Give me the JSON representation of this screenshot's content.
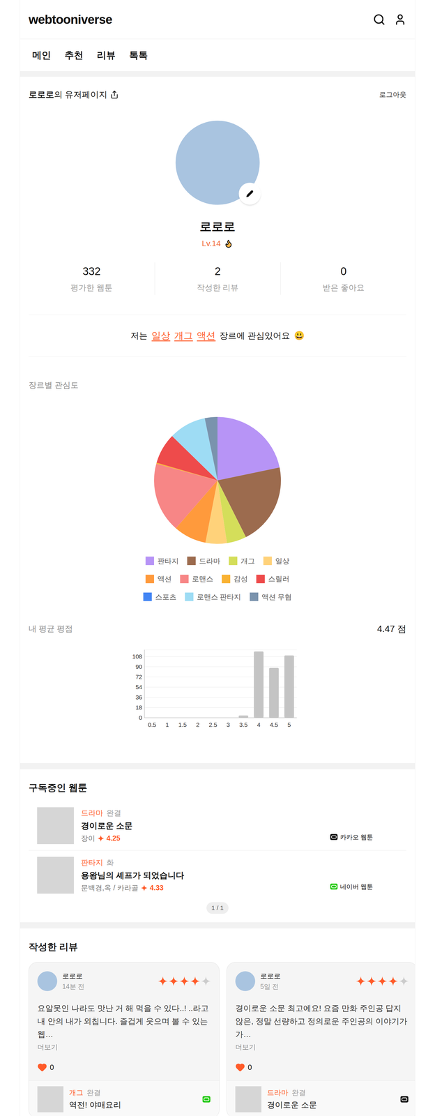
{
  "header": {
    "logo": "webtooniverse"
  },
  "nav": [
    {
      "label": "메인"
    },
    {
      "label": "추천"
    },
    {
      "label": "리뷰"
    },
    {
      "label": "톡톡"
    }
  ],
  "profile": {
    "owner": "로로로",
    "owner_suffix": "의 유저페이지",
    "logout": "로그아웃",
    "name": "로로로",
    "level": "Lv.14",
    "stats": [
      {
        "value": "332",
        "label": "평가한 웹툰"
      },
      {
        "value": "2",
        "label": "작성한 리뷰"
      },
      {
        "value": "0",
        "label": "받은 좋아요"
      }
    ],
    "interest": {
      "prefix": "저는",
      "genres": [
        "일상",
        "개그",
        "액션"
      ],
      "suffix": "장르에 관심있어요",
      "emoji": "😃"
    }
  },
  "genre_chart": {
    "title": "장르별 관심도",
    "slices": [
      {
        "label": "판타지",
        "value": 78,
        "color": "#b794f6"
      },
      {
        "label": "드라마",
        "value": 75,
        "color": "#9c6b4e"
      },
      {
        "label": "개그",
        "value": 18,
        "color": "#d4de5a"
      },
      {
        "label": "일상",
        "value": 19.5,
        "color": "#ffd27a"
      },
      {
        "label": "액션",
        "value": 30,
        "color": "#ff9a3c"
      },
      {
        "label": "로맨스",
        "value": 64,
        "color": "#f78686"
      },
      {
        "label": "감성",
        "value": 1,
        "color": "#f9b233"
      },
      {
        "label": "스릴러",
        "value": 28,
        "color": "#ee4b4b"
      },
      {
        "label": "스포츠",
        "value": 0,
        "color": "#4285f4"
      },
      {
        "label": "로맨스 판타지",
        "value": 34,
        "color": "#9edcf4"
      },
      {
        "label": "액션 무협",
        "value": 11.6,
        "color": "#7a93ad"
      }
    ]
  },
  "rating_chart": {
    "title": "내 평균 평점",
    "average": "4.47 점",
    "y_ticks": [
      "0",
      "18",
      "36",
      "54",
      "72",
      "90",
      "108"
    ],
    "x_labels": [
      "0.5",
      "1",
      "1.5",
      "2",
      "2.5",
      "3",
      "3.5",
      "4",
      "4.5",
      "5"
    ],
    "values": [
      0,
      0,
      0,
      0,
      0,
      0,
      4,
      117,
      88,
      110
    ]
  },
  "subscriptions": {
    "title": "구독중인 웹툰",
    "items": [
      {
        "genre": "드라마",
        "status": "완결",
        "title": "경이로운 소문",
        "author": "장이",
        "rating": "4.25",
        "platform": "카카오 웹툰",
        "color": "#000000"
      },
      {
        "genre": "판타지",
        "status": "화",
        "title": "용왕님의 셰프가 되었습니다",
        "author": "문백경,옥 / 카라골",
        "rating": "4.33",
        "platform": "네이버 웹툰",
        "color": "#1ec800"
      }
    ],
    "pagination": "1 / 1"
  },
  "reviews": {
    "title": "작성한 리뷰",
    "items": [
      {
        "user": "로로로",
        "time": "14분 전",
        "stars": 4,
        "text": "요알못인 나라도 맛난 거 해 먹을 수 있다..! ..라고 내 안의 내가 외칩니다. 즐겁게 웃으며 볼 수 있는 웹…",
        "more": "더보기",
        "likes": "0",
        "webtoon": {
          "genre": "개그",
          "status": "완결",
          "title": "역전! 야매요리",
          "color": "#1ec800"
        }
      },
      {
        "user": "로로로",
        "time": "5일 전",
        "stars": 4,
        "text": "경이로운 소문 최고에요! 요즘 만화 주인공 답지 않은, 정말 선량하고 정의로운 주인공의 이야기가 가…",
        "more": "더보기",
        "likes": "0",
        "webtoon": {
          "genre": "드라마",
          "status": "완결",
          "title": "경이로운 소문",
          "color": "#000000"
        }
      }
    ]
  }
}
